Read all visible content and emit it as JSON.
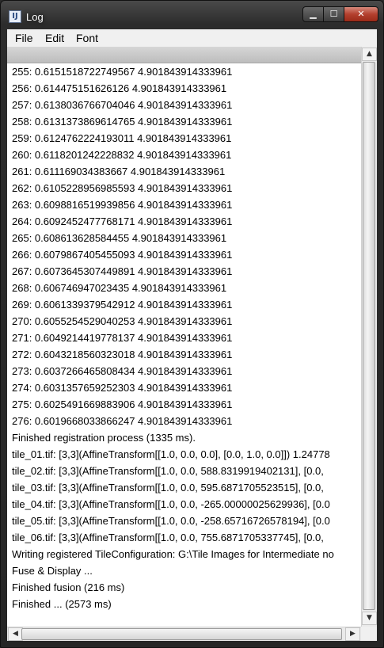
{
  "window": {
    "title": "Log",
    "app_icon": "imagej-icon",
    "min_glyph": "▁",
    "max_glyph": "☐",
    "close_glyph": "✕"
  },
  "menubar": {
    "items": [
      "File",
      "Edit",
      "Font"
    ]
  },
  "log": {
    "lines": [
      "255: 0.6151518722749567 4.901843914333961",
      "256: 0.614475151626126 4.901843914333961",
      "257: 0.6138036766704046 4.901843914333961",
      "258: 0.6131373869614765 4.901843914333961",
      "259: 0.6124762224193011 4.901843914333961",
      "260: 0.6118201242228832 4.901843914333961",
      "261: 0.611169034383667 4.901843914333961",
      "262: 0.6105228956985593 4.901843914333961",
      "263: 0.6098816519939856 4.901843914333961",
      "264: 0.6092452477768171 4.901843914333961",
      "265: 0.608613628584455 4.901843914333961",
      "266: 0.6079867405455093 4.901843914333961",
      "267: 0.6073645307449891 4.901843914333961",
      "268: 0.606746947023435 4.901843914333961",
      "269: 0.6061339379542912 4.901843914333961",
      "270: 0.6055254529040253 4.901843914333961",
      "271: 0.6049214419778137 4.901843914333961",
      "272: 0.6043218560323018 4.901843914333961",
      "273: 0.6037266465808434 4.901843914333961",
      "274: 0.6031357659252303 4.901843914333961",
      "275: 0.6025491669883906 4.901843914333961",
      "276: 0.6019668033866247 4.901843914333961",
      "Finished registration process (1335 ms).",
      "tile_01.tif: [3,3](AffineTransform[[1.0, 0.0, 0.0], [0.0, 1.0, 0.0]]) 1.24778",
      "tile_02.tif: [3,3](AffineTransform[[1.0, 0.0, 588.8319919402131], [0.0,",
      "tile_03.tif: [3,3](AffineTransform[[1.0, 0.0, 595.6871705523515], [0.0,",
      "tile_04.tif: [3,3](AffineTransform[[1.0, 0.0, -265.00000025629936], [0.0",
      "tile_05.tif: [3,3](AffineTransform[[1.0, 0.0, -258.65716726578194], [0.0",
      "tile_06.tif: [3,3](AffineTransform[[1.0, 0.0, 755.6871705337745], [0.0,",
      "Writing registered TileConfiguration: G:\\Tile Images for Intermediate no",
      "Fuse & Display ...",
      "Finished fusion (216 ms)",
      "Finished ... (2573 ms)"
    ]
  },
  "scrollbars": {
    "up": "▲",
    "down": "▼",
    "left": "◀",
    "right": "▶"
  }
}
